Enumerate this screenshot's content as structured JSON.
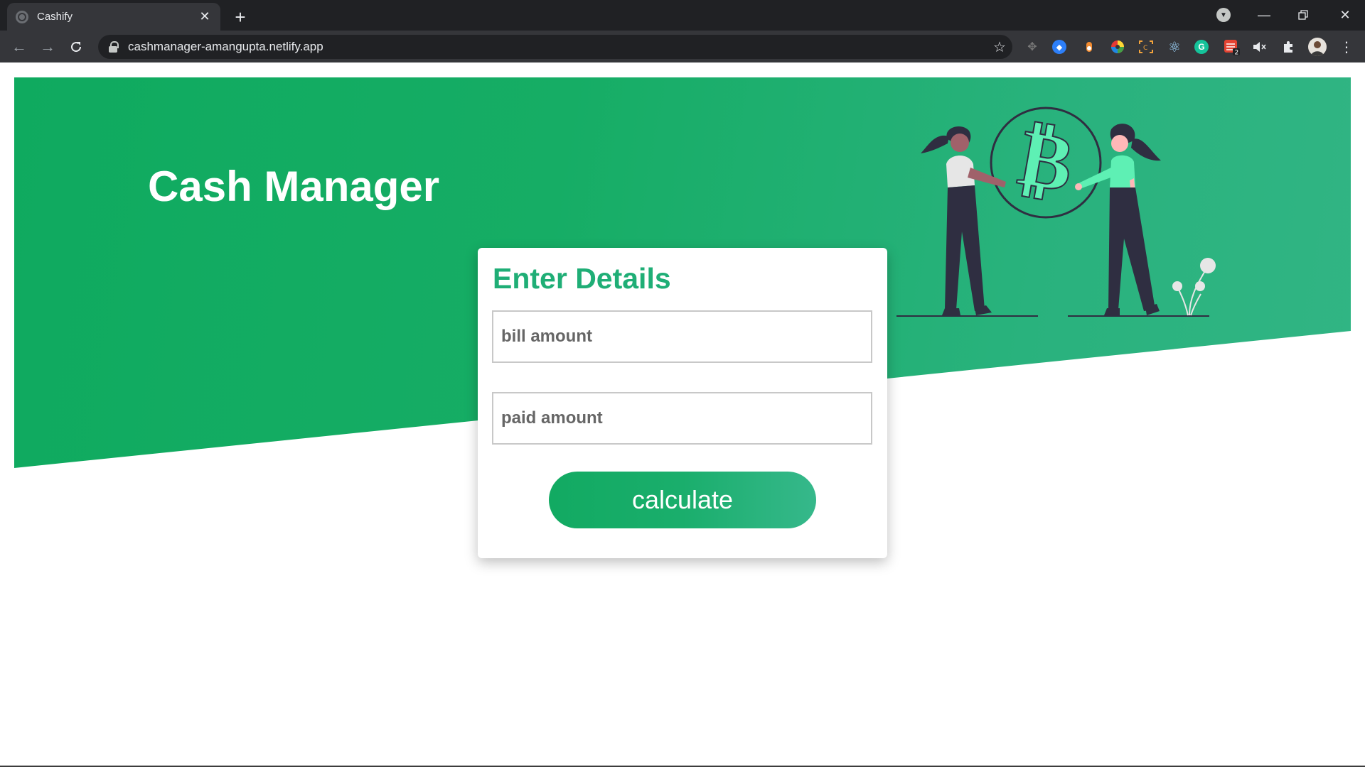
{
  "browser": {
    "tab_title": "Cashify",
    "new_tab_symbol": "+",
    "url": "cashmanager-amangupta.netlify.app",
    "extension_badge": "2"
  },
  "page": {
    "hero_title": "Cash Manager",
    "card_title": "Enter Details",
    "bill_placeholder": "bill amount",
    "paid_placeholder": "paid amount",
    "calculate_label": "calculate"
  },
  "colors": {
    "hero_green": "#0faa5f",
    "accent_green": "#1fae76",
    "illustration_mint": "#5ef0b4",
    "dark_figure": "#2f2e41"
  }
}
